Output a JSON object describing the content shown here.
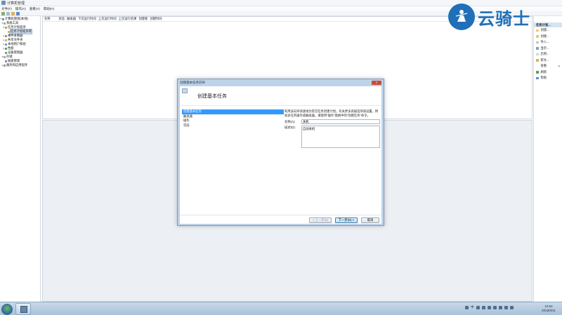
{
  "window": {
    "title": "计算机管理"
  },
  "menubar": {
    "items": [
      "文件(F)",
      "操作(A)",
      "查看(V)",
      "帮助(H)"
    ]
  },
  "navtree": {
    "items": [
      {
        "label": "计算机管理(本地)",
        "twisty": "▾"
      },
      {
        "label": "系统工具",
        "twisty": "▾"
      },
      {
        "label": "任务计划程序",
        "twisty": "▾"
      },
      {
        "label": "任务计划程序库",
        "twisty": ""
      },
      {
        "label": "事件查看器",
        "twisty": "▸"
      },
      {
        "label": "共享文件夹",
        "twisty": "▸"
      },
      {
        "label": "本地用户和组",
        "twisty": "▸"
      },
      {
        "label": "性能",
        "twisty": "▸"
      },
      {
        "label": "设备管理器",
        "twisty": ""
      },
      {
        "label": "存储",
        "twisty": "▾"
      },
      {
        "label": "磁盘管理",
        "twisty": ""
      },
      {
        "label": "服务和应用程序",
        "twisty": "▸"
      }
    ]
  },
  "content": {
    "columns": [
      "名称",
      "状态",
      "触发器",
      "下次运行时间",
      "上次运行时间",
      "上次运行结果",
      "创建者",
      "创建时间"
    ]
  },
  "actions": {
    "header": "任务计划...",
    "items": [
      {
        "label": "创建...",
        "arrow": ""
      },
      {
        "label": "创建...",
        "arrow": ""
      },
      {
        "label": "导入...",
        "arrow": ""
      },
      {
        "label": "显示...",
        "arrow": ""
      },
      {
        "label": "启用...",
        "arrow": ""
      },
      {
        "label": "新文...",
        "arrow": ""
      },
      {
        "label": "查看",
        "arrow": "▸"
      },
      {
        "label": "刷新",
        "arrow": ""
      },
      {
        "label": "帮助",
        "arrow": ""
      }
    ]
  },
  "wizard": {
    "title": "创建基本任务向导",
    "close": "×",
    "heading": "创建基本任务",
    "steps": [
      "创建基本任务",
      "触发器",
      "操作",
      "完成"
    ],
    "description": "利用该向导快速地为常见任务创建计划。有关更多高级选项或设置，例如多任务操作或触发器，请使用“操作”窗格中的“创建任务”命令。",
    "name_label": "名称(A):",
    "name_value": "关机",
    "desc_label": "描述(D):",
    "desc_value": "自动关机",
    "btn_prev": "< 上一步(B)",
    "btn_next": "下一步(N) >",
    "btn_cancel": "取消"
  },
  "taskbar": {
    "tray_lang": "中",
    "time": "10:52",
    "date": "2019/3/11"
  },
  "watermark": {
    "text": "云骑士"
  }
}
